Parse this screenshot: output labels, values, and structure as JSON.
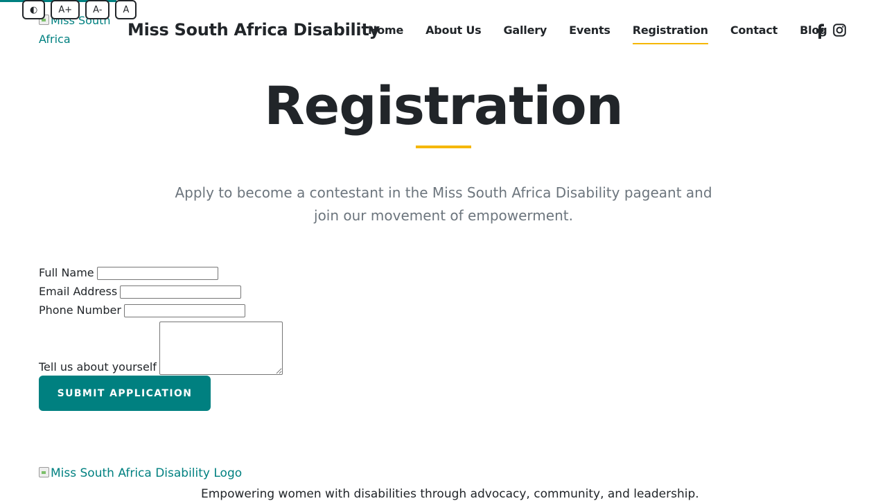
{
  "accessibility": {
    "contrast_label": "◐",
    "increase_label": "A+",
    "decrease_label": "A-",
    "reset_label": "A"
  },
  "header": {
    "logo_alt": "Miss South Africa",
    "site_title": "Miss South Africa Disability"
  },
  "nav": {
    "items": [
      {
        "label": "Home"
      },
      {
        "label": "About Us"
      },
      {
        "label": "Gallery"
      },
      {
        "label": "Events"
      },
      {
        "label": "Registration",
        "active": true
      },
      {
        "label": "Contact"
      },
      {
        "label": "Blog"
      }
    ],
    "social": [
      {
        "icon": "facebook-icon"
      },
      {
        "icon": "instagram-icon"
      }
    ]
  },
  "hero": {
    "title": "Registration",
    "subtitle": "Apply to become a contestant in the Miss South Africa Disability pageant and join our movement of empowerment."
  },
  "form": {
    "full_name_label": "Full Name",
    "full_name_value": "",
    "email_label": "Email Address",
    "email_value": "",
    "phone_label": "Phone Number",
    "phone_value": "",
    "about_label": "Tell us about yourself",
    "about_value": "",
    "submit_label": "SUBMIT APPLICATION"
  },
  "footer": {
    "logo_alt": "Miss South Africa Disability Logo",
    "tagline": "Empowering women with disabilities through advocacy, community, and leadership."
  },
  "colors": {
    "accent": "#008080",
    "highlight": "#f5b700",
    "text": "#212529",
    "muted": "#6c757d"
  }
}
